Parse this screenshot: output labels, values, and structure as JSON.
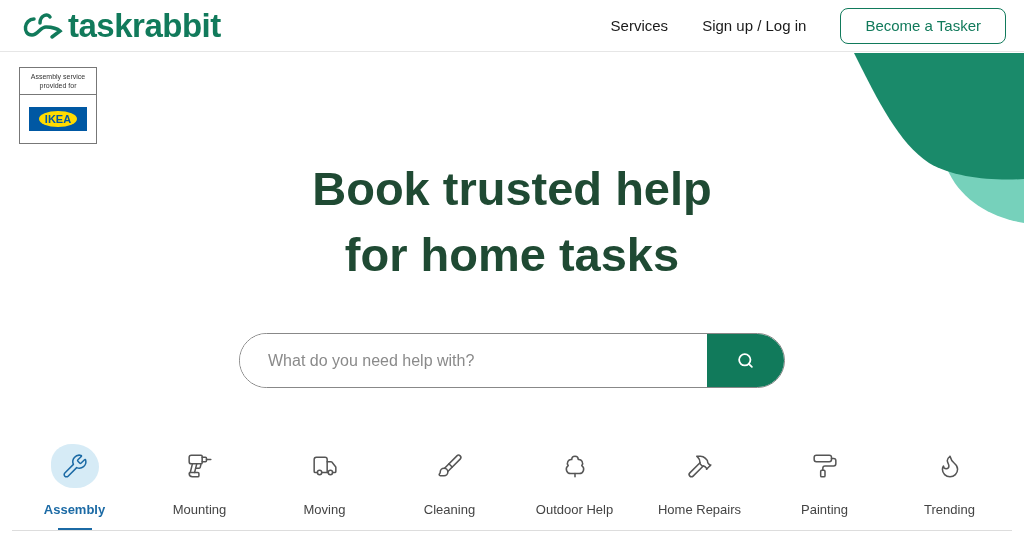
{
  "header": {
    "logo": "taskrabbit",
    "nav": [
      {
        "label": "Services",
        "kind": "link"
      },
      {
        "label": "Sign up / Log in",
        "kind": "link"
      },
      {
        "label": "Become a Tasker",
        "kind": "outline"
      }
    ]
  },
  "partner_badge": {
    "caption": "Assembly service provided for",
    "brand": "IKEA"
  },
  "hero": {
    "title_lines": [
      "Book trusted help",
      "for home tasks"
    ]
  },
  "search": {
    "placeholder": "What do you need help with?"
  },
  "categories": [
    {
      "label": "Assembly",
      "selected": true
    },
    {
      "label": "Mounting",
      "selected": false
    },
    {
      "label": "Moving",
      "selected": false
    },
    {
      "label": "Cleaning",
      "selected": false
    },
    {
      "label": "Outdoor Help",
      "selected": false
    },
    {
      "label": "Home Repairs",
      "selected": false
    },
    {
      "label": "Painting",
      "selected": false
    },
    {
      "label": "Trending",
      "selected": false
    }
  ]
}
